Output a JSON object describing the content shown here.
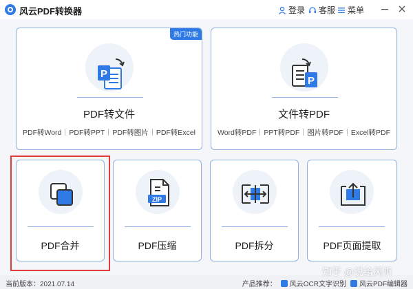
{
  "app": {
    "title": "风云PDF转换器",
    "login_label": "登录",
    "service_label": "客服",
    "menu_label": "菜单",
    "minimize_icon": "minimize-icon",
    "close_icon": "close-icon"
  },
  "cards": {
    "pdf_to_file": {
      "title": "PDF转文件",
      "badge": "热门功能",
      "links": [
        "PDF转Word",
        "PDF转PPT",
        "PDF转图片",
        "PDF转Excel"
      ]
    },
    "file_to_pdf": {
      "title": "文件转PDF",
      "links": [
        "Word转PDF",
        "PPT转PDF",
        "图片转PDF",
        "Excel转PDF"
      ]
    },
    "merge": {
      "title": "PDF合并"
    },
    "compress": {
      "title": "PDF压缩",
      "zip_text": "ZIP"
    },
    "split": {
      "title": "PDF拆分"
    },
    "extract": {
      "title": "PDF页面提取"
    }
  },
  "status": {
    "version": "当前版本：2021.07.14",
    "products_label": "产品推荐：",
    "product1": "风云OCR文字识别",
    "product2": "风云PDF编辑器"
  },
  "watermark": "知乎 @说给风听",
  "colors": {
    "accent": "#2f7ae5",
    "card_border": "#8fb2e0",
    "highlight": "#e23b3b"
  }
}
